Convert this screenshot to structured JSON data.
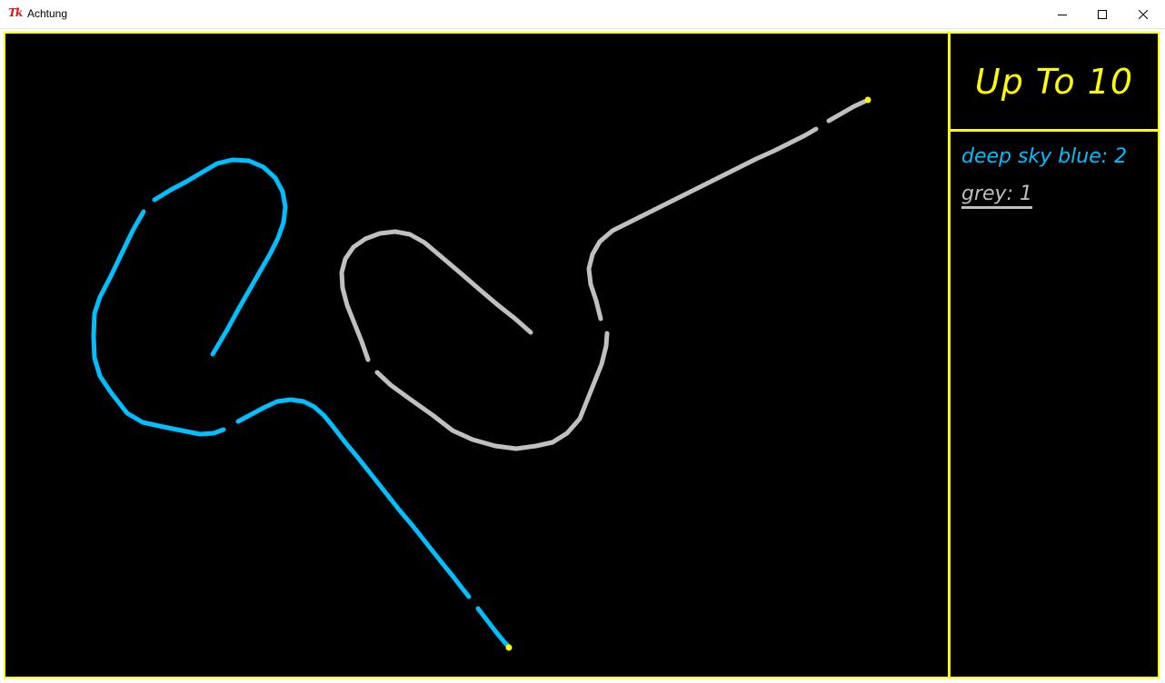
{
  "window": {
    "title": "Achtung",
    "icon": "tk-feather-icon",
    "icon_text": "Tk"
  },
  "board": {
    "goal_text": "Up To 10",
    "border_color": "#ffff00",
    "background": "#000000"
  },
  "players": [
    {
      "label": "deep sky blue: 2",
      "color": "#00bfff",
      "active": false
    },
    {
      "label": "grey: 1",
      "color": "#bebebe",
      "active": true
    }
  ],
  "trails": [
    {
      "color": "#00bfff",
      "segments": [
        [
          [
            234,
            390
          ],
          [
            240,
            380
          ],
          [
            250,
            363
          ],
          [
            262,
            341
          ],
          [
            274,
            320
          ],
          [
            286,
            299
          ],
          [
            297,
            280
          ],
          [
            306,
            262
          ],
          [
            312,
            245
          ],
          [
            314,
            228
          ],
          [
            311,
            211
          ],
          [
            303,
            196
          ],
          [
            290,
            184
          ],
          [
            274,
            177
          ],
          [
            256,
            176
          ],
          [
            239,
            180
          ],
          [
            222,
            190
          ],
          [
            205,
            200
          ],
          [
            188,
            209
          ],
          [
            170,
            220
          ]
        ],
        [
          [
            158,
            233
          ],
          [
            146,
            254
          ],
          [
            134,
            279
          ],
          [
            122,
            304
          ],
          [
            110,
            327
          ],
          [
            104,
            345
          ],
          [
            103,
            370
          ],
          [
            104,
            394
          ],
          [
            110,
            414
          ],
          [
            122,
            432
          ],
          [
            140,
            455
          ],
          [
            157,
            465
          ],
          [
            180,
            470
          ],
          [
            200,
            474
          ],
          [
            220,
            478
          ],
          [
            235,
            477
          ],
          [
            246,
            473
          ]
        ],
        [
          [
            262,
            464
          ],
          [
            277,
            456
          ],
          [
            290,
            449
          ],
          [
            305,
            442
          ],
          [
            320,
            440
          ],
          [
            334,
            442
          ],
          [
            346,
            448
          ],
          [
            357,
            458
          ],
          [
            366,
            469
          ],
          [
            379,
            486
          ],
          [
            394,
            504
          ],
          [
            409,
            523
          ],
          [
            424,
            542
          ],
          [
            439,
            561
          ],
          [
            455,
            580
          ],
          [
            470,
            599
          ],
          [
            485,
            618
          ],
          [
            498,
            634
          ],
          [
            508,
            647
          ],
          [
            516,
            657
          ]
        ],
        [
          [
            526,
            670
          ],
          [
            536,
            683
          ],
          [
            546,
            696
          ],
          [
            555,
            707
          ],
          [
            560,
            712
          ]
        ]
      ],
      "head": [
        560,
        713
      ]
    },
    {
      "color": "#c0c0c0",
      "segments": [
        [
          [
            584,
            366
          ],
          [
            567,
            351
          ],
          [
            548,
            336
          ],
          [
            528,
            319
          ],
          [
            506,
            300
          ],
          [
            486,
            283
          ],
          [
            467,
            267
          ],
          [
            451,
            258
          ],
          [
            435,
            255
          ],
          [
            418,
            257
          ],
          [
            402,
            263
          ],
          [
            389,
            272
          ],
          [
            380,
            285
          ],
          [
            376,
            300
          ],
          [
            377,
            317
          ],
          [
            382,
            336
          ],
          [
            390,
            356
          ],
          [
            398,
            376
          ],
          [
            405,
            396
          ]
        ],
        [
          [
            415,
            410
          ],
          [
            430,
            424
          ],
          [
            452,
            440
          ],
          [
            476,
            457
          ],
          [
            498,
            474
          ],
          [
            520,
            484
          ],
          [
            545,
            491
          ],
          [
            568,
            494
          ],
          [
            590,
            491
          ],
          [
            608,
            487
          ],
          [
            624,
            477
          ],
          [
            638,
            461
          ],
          [
            646,
            441
          ],
          [
            654,
            421
          ],
          [
            662,
            401
          ],
          [
            667,
            381
          ],
          [
            668,
            367
          ]
        ],
        [
          [
            661,
            351
          ],
          [
            656,
            331
          ],
          [
            650,
            313
          ],
          [
            648,
            296
          ],
          [
            652,
            280
          ],
          [
            660,
            266
          ],
          [
            674,
            254
          ],
          [
            692,
            245
          ],
          [
            712,
            235
          ],
          [
            732,
            225
          ],
          [
            752,
            215
          ],
          [
            772,
            205
          ],
          [
            792,
            195
          ],
          [
            812,
            185
          ],
          [
            832,
            175
          ],
          [
            852,
            166
          ],
          [
            872,
            156
          ],
          [
            886,
            149
          ],
          [
            898,
            142
          ]
        ],
        [
          [
            912,
            133
          ],
          [
            926,
            125
          ],
          [
            940,
            117
          ],
          [
            951,
            112
          ]
        ]
      ],
      "head": [
        955,
        110
      ]
    }
  ]
}
